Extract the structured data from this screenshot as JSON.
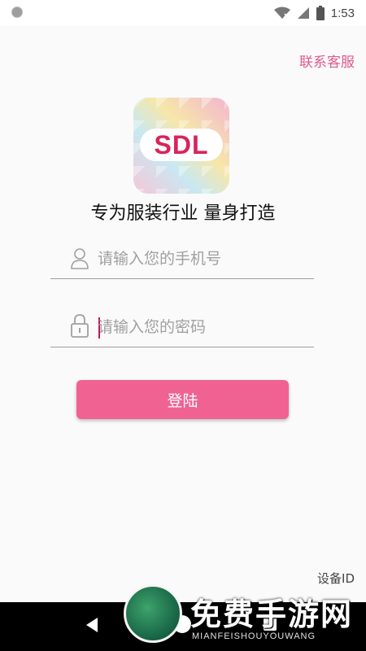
{
  "status_bar": {
    "time": "1:53"
  },
  "header": {
    "contact_label": "联系客服"
  },
  "logo": {
    "text": "SDL"
  },
  "slogan": "专为服装行业 量身打造",
  "form": {
    "phone_placeholder": "请输入您的手机号",
    "password_placeholder": "请输入您的密码",
    "login_label": "登陆"
  },
  "footer": {
    "device_id_label": "设备ID"
  },
  "watermark": {
    "title": "免费手游网",
    "subtitle": "MIANFEISHOUYOUWANG"
  },
  "colors": {
    "accent": "#f06292",
    "link": "#e05a8d"
  }
}
